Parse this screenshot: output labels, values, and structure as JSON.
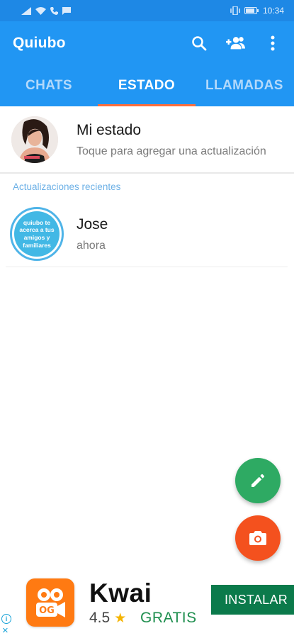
{
  "statusbar": {
    "time": "10:34"
  },
  "appbar": {
    "title": "Quiubo"
  },
  "tabs": [
    {
      "label": "CHATS"
    },
    {
      "label": "ESTADO"
    },
    {
      "label": "LLAMADAS"
    }
  ],
  "my_status": {
    "title": "Mi estado",
    "subtitle": "Toque para agregar una actualización"
  },
  "recent": {
    "section_label": "Actualizaciones recientes",
    "items": [
      {
        "name": "Jose",
        "time": "ahora",
        "avatar_text": "quiubo te acerca a tus amigos y familiares"
      }
    ]
  },
  "ad": {
    "app_name": "Kwai",
    "rating": "4.5",
    "price": "GRATIS",
    "cta": "INSTALAR",
    "info_icon": "i",
    "close_icon": "×"
  },
  "colors": {
    "statusbar": "#1e88e5",
    "appbar": "#2196f3",
    "tab_indicator": "#ff6d3a",
    "fab_edit": "#2eaa63",
    "fab_camera": "#f4511e",
    "ad_cta": "#0b7a4b"
  },
  "icons": {
    "appbar": [
      "search-icon",
      "add-contact-icon",
      "more-vert-icon"
    ],
    "fabs": [
      "pencil-icon",
      "camera-icon"
    ]
  }
}
